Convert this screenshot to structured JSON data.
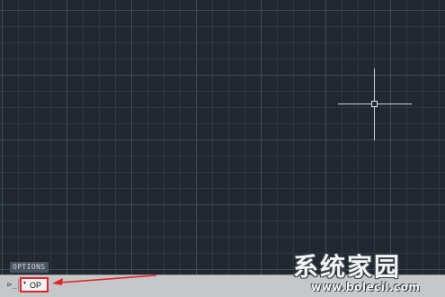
{
  "canvas": {
    "background": "#212830",
    "grid_color": "#58647a",
    "crosshair_color": "#c9ced6"
  },
  "autocomplete": {
    "hint": "OPTIONS"
  },
  "command_line": {
    "prompt_icon": "command-prompt-icon",
    "chevron": "▾",
    "input_value": "OP",
    "highlight_color": "#e0252b"
  },
  "annotation": {
    "arrow_color": "#e0252b"
  },
  "watermark": {
    "title": "系统家园",
    "url": "www.bolecil.com"
  }
}
